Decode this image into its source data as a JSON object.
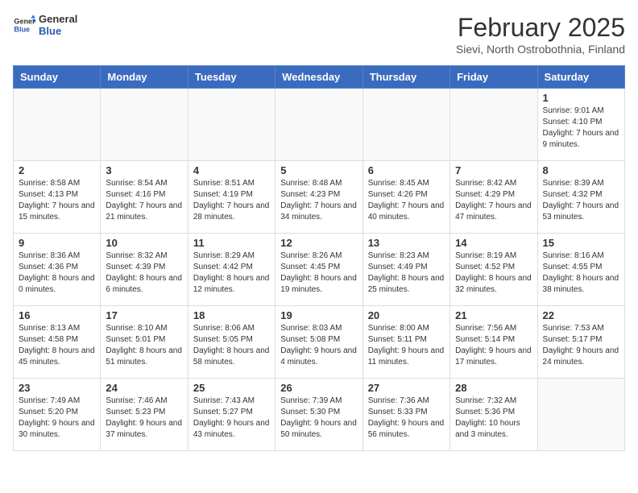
{
  "header": {
    "logo_general": "General",
    "logo_blue": "Blue",
    "month_title": "February 2025",
    "location": "Sievi, North Ostrobothnia, Finland"
  },
  "weekdays": [
    "Sunday",
    "Monday",
    "Tuesday",
    "Wednesday",
    "Thursday",
    "Friday",
    "Saturday"
  ],
  "weeks": [
    [
      {
        "day": "",
        "info": ""
      },
      {
        "day": "",
        "info": ""
      },
      {
        "day": "",
        "info": ""
      },
      {
        "day": "",
        "info": ""
      },
      {
        "day": "",
        "info": ""
      },
      {
        "day": "",
        "info": ""
      },
      {
        "day": "1",
        "info": "Sunrise: 9:01 AM\nSunset: 4:10 PM\nDaylight: 7 hours and 9 minutes."
      }
    ],
    [
      {
        "day": "2",
        "info": "Sunrise: 8:58 AM\nSunset: 4:13 PM\nDaylight: 7 hours and 15 minutes."
      },
      {
        "day": "3",
        "info": "Sunrise: 8:54 AM\nSunset: 4:16 PM\nDaylight: 7 hours and 21 minutes."
      },
      {
        "day": "4",
        "info": "Sunrise: 8:51 AM\nSunset: 4:19 PM\nDaylight: 7 hours and 28 minutes."
      },
      {
        "day": "5",
        "info": "Sunrise: 8:48 AM\nSunset: 4:23 PM\nDaylight: 7 hours and 34 minutes."
      },
      {
        "day": "6",
        "info": "Sunrise: 8:45 AM\nSunset: 4:26 PM\nDaylight: 7 hours and 40 minutes."
      },
      {
        "day": "7",
        "info": "Sunrise: 8:42 AM\nSunset: 4:29 PM\nDaylight: 7 hours and 47 minutes."
      },
      {
        "day": "8",
        "info": "Sunrise: 8:39 AM\nSunset: 4:32 PM\nDaylight: 7 hours and 53 minutes."
      }
    ],
    [
      {
        "day": "9",
        "info": "Sunrise: 8:36 AM\nSunset: 4:36 PM\nDaylight: 8 hours and 0 minutes."
      },
      {
        "day": "10",
        "info": "Sunrise: 8:32 AM\nSunset: 4:39 PM\nDaylight: 8 hours and 6 minutes."
      },
      {
        "day": "11",
        "info": "Sunrise: 8:29 AM\nSunset: 4:42 PM\nDaylight: 8 hours and 12 minutes."
      },
      {
        "day": "12",
        "info": "Sunrise: 8:26 AM\nSunset: 4:45 PM\nDaylight: 8 hours and 19 minutes."
      },
      {
        "day": "13",
        "info": "Sunrise: 8:23 AM\nSunset: 4:49 PM\nDaylight: 8 hours and 25 minutes."
      },
      {
        "day": "14",
        "info": "Sunrise: 8:19 AM\nSunset: 4:52 PM\nDaylight: 8 hours and 32 minutes."
      },
      {
        "day": "15",
        "info": "Sunrise: 8:16 AM\nSunset: 4:55 PM\nDaylight: 8 hours and 38 minutes."
      }
    ],
    [
      {
        "day": "16",
        "info": "Sunrise: 8:13 AM\nSunset: 4:58 PM\nDaylight: 8 hours and 45 minutes."
      },
      {
        "day": "17",
        "info": "Sunrise: 8:10 AM\nSunset: 5:01 PM\nDaylight: 8 hours and 51 minutes."
      },
      {
        "day": "18",
        "info": "Sunrise: 8:06 AM\nSunset: 5:05 PM\nDaylight: 8 hours and 58 minutes."
      },
      {
        "day": "19",
        "info": "Sunrise: 8:03 AM\nSunset: 5:08 PM\nDaylight: 9 hours and 4 minutes."
      },
      {
        "day": "20",
        "info": "Sunrise: 8:00 AM\nSunset: 5:11 PM\nDaylight: 9 hours and 11 minutes."
      },
      {
        "day": "21",
        "info": "Sunrise: 7:56 AM\nSunset: 5:14 PM\nDaylight: 9 hours and 17 minutes."
      },
      {
        "day": "22",
        "info": "Sunrise: 7:53 AM\nSunset: 5:17 PM\nDaylight: 9 hours and 24 minutes."
      }
    ],
    [
      {
        "day": "23",
        "info": "Sunrise: 7:49 AM\nSunset: 5:20 PM\nDaylight: 9 hours and 30 minutes."
      },
      {
        "day": "24",
        "info": "Sunrise: 7:46 AM\nSunset: 5:23 PM\nDaylight: 9 hours and 37 minutes."
      },
      {
        "day": "25",
        "info": "Sunrise: 7:43 AM\nSunset: 5:27 PM\nDaylight: 9 hours and 43 minutes."
      },
      {
        "day": "26",
        "info": "Sunrise: 7:39 AM\nSunset: 5:30 PM\nDaylight: 9 hours and 50 minutes."
      },
      {
        "day": "27",
        "info": "Sunrise: 7:36 AM\nSunset: 5:33 PM\nDaylight: 9 hours and 56 minutes."
      },
      {
        "day": "28",
        "info": "Sunrise: 7:32 AM\nSunset: 5:36 PM\nDaylight: 10 hours and 3 minutes."
      },
      {
        "day": "",
        "info": ""
      }
    ]
  ]
}
